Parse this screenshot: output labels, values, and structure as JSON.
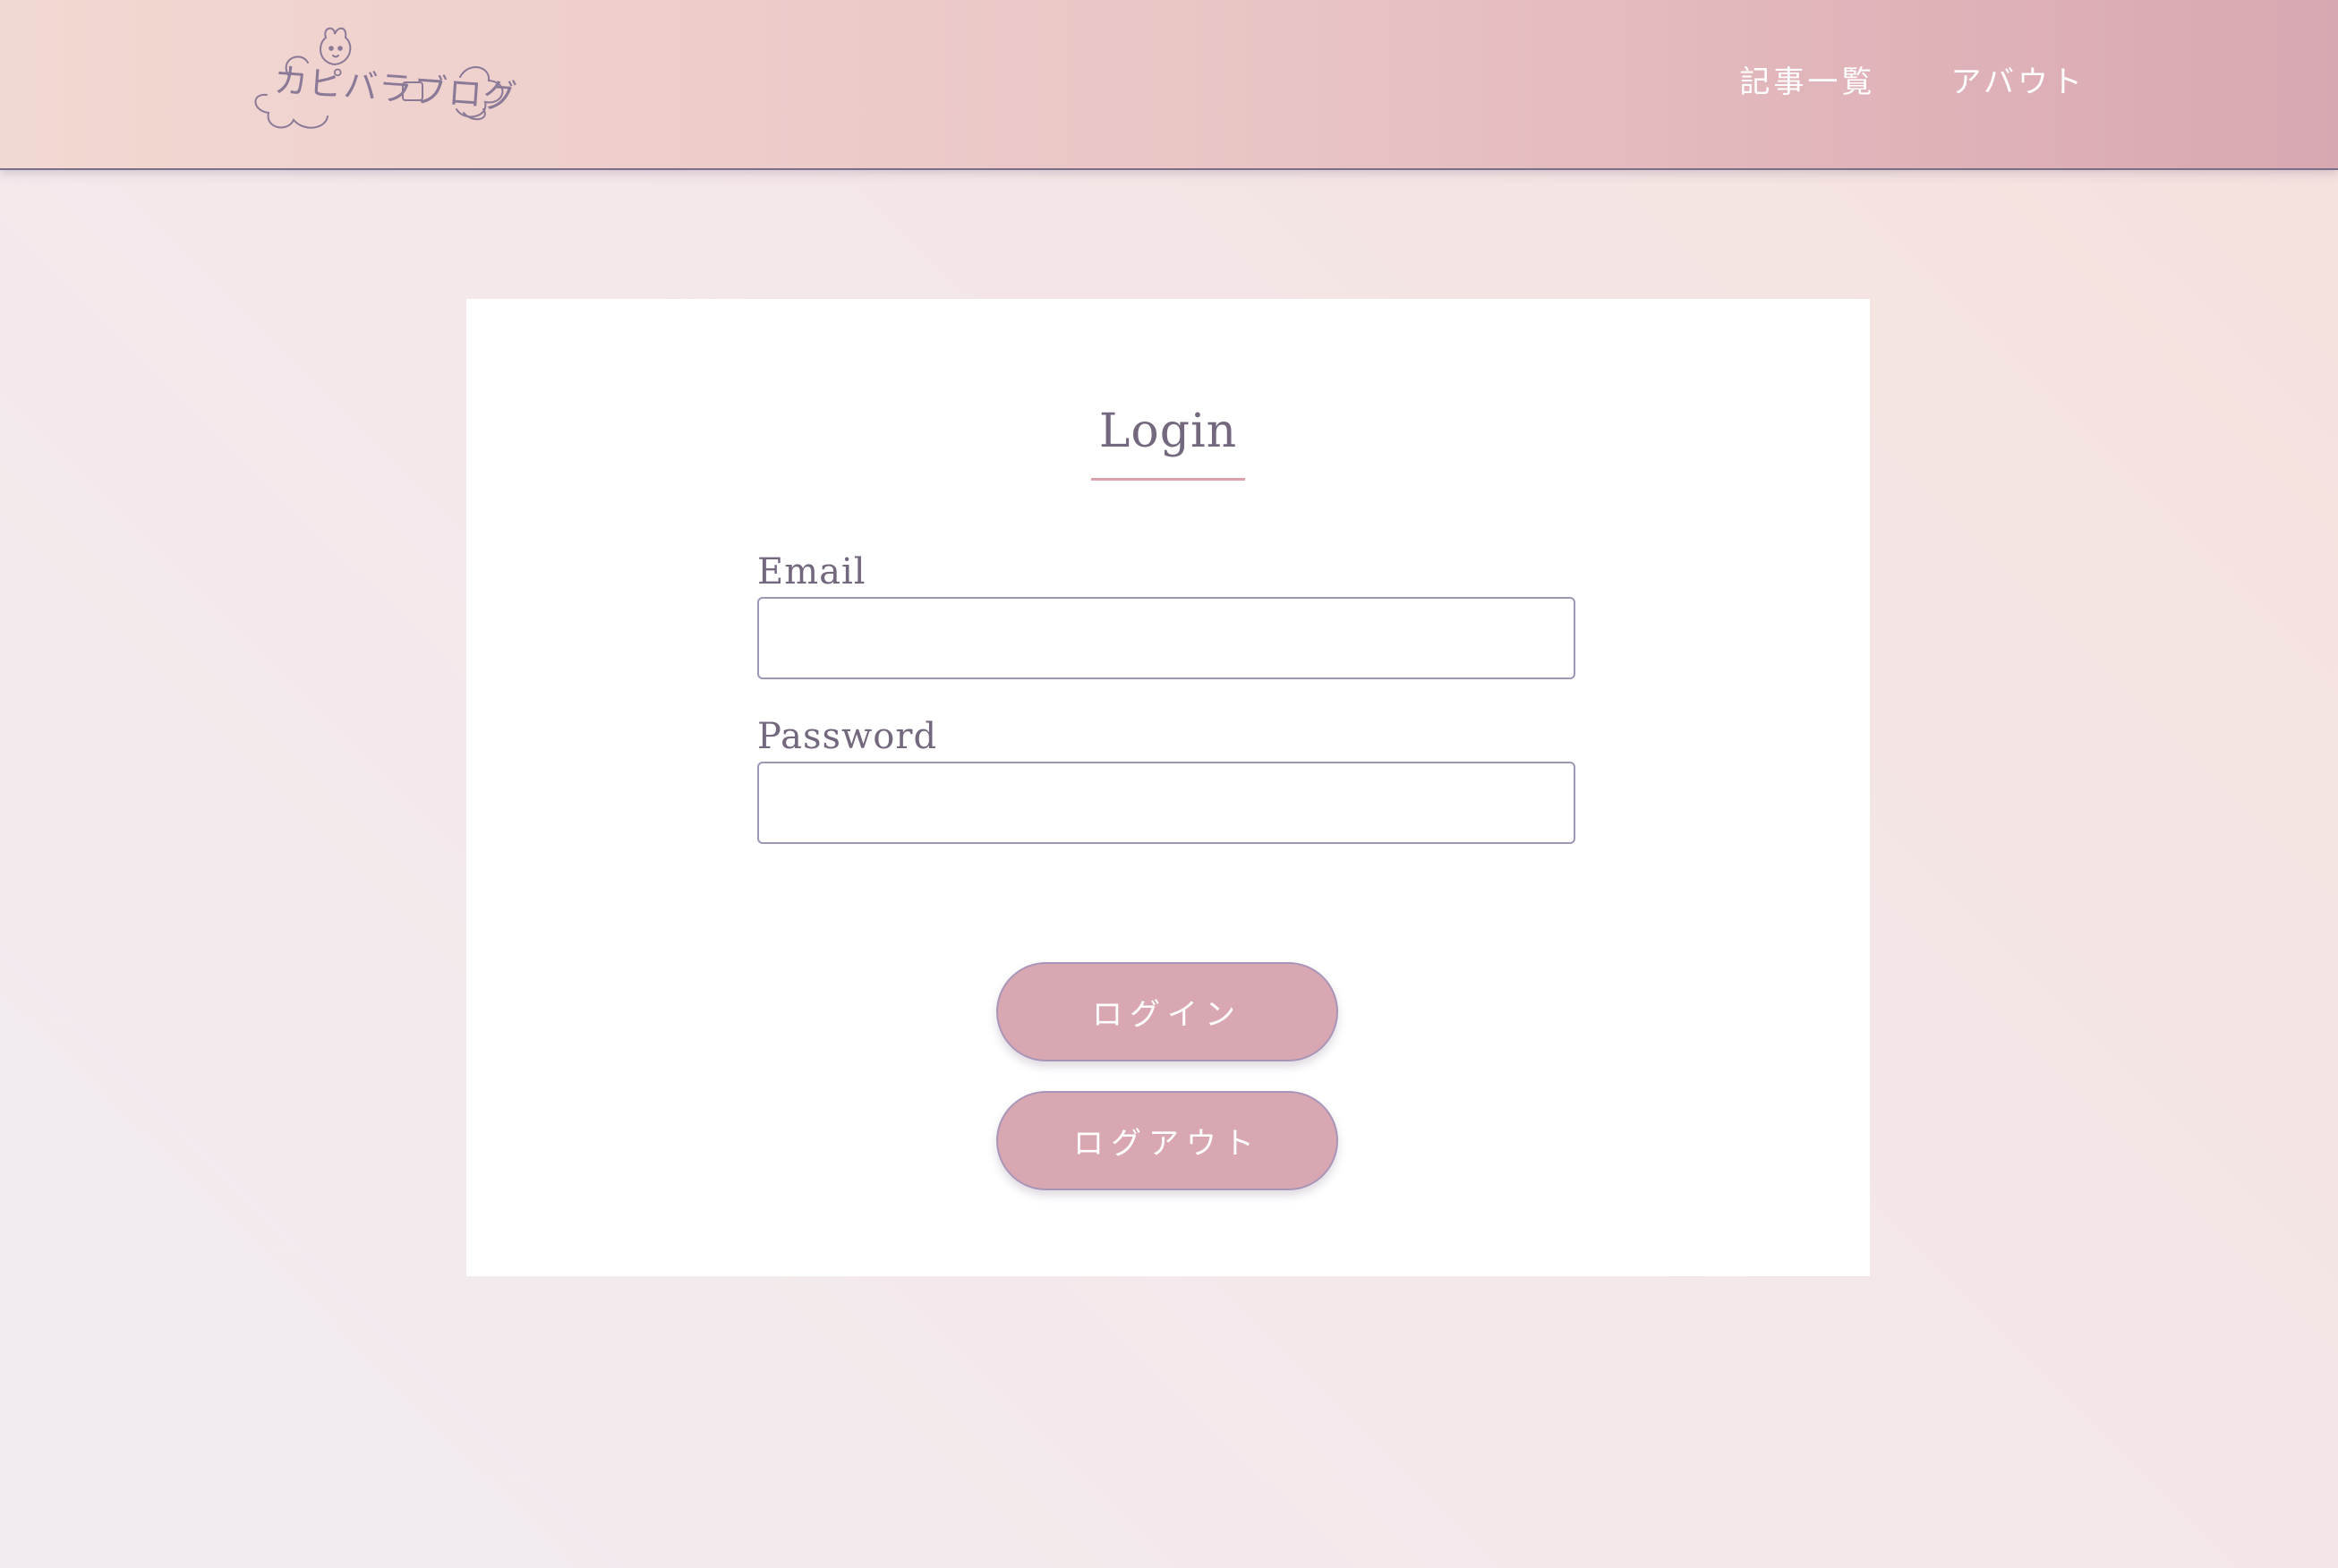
{
  "header": {
    "logo_text": "カピバラブログ",
    "nav": [
      {
        "label": "記事一覧"
      },
      {
        "label": "アバウト"
      }
    ]
  },
  "login": {
    "title": "Login",
    "email_label": "Email",
    "email_value": "",
    "password_label": "Password",
    "password_value": "",
    "login_button": "ログイン",
    "logout_button": "ログアウト"
  },
  "colors": {
    "header_start": "#f2d8d2",
    "header_end": "#d9a7b1",
    "button": "#d9a7b1",
    "text": "#74687f",
    "accent_underline": "#dca1ab",
    "input_border": "#9f95b4"
  }
}
